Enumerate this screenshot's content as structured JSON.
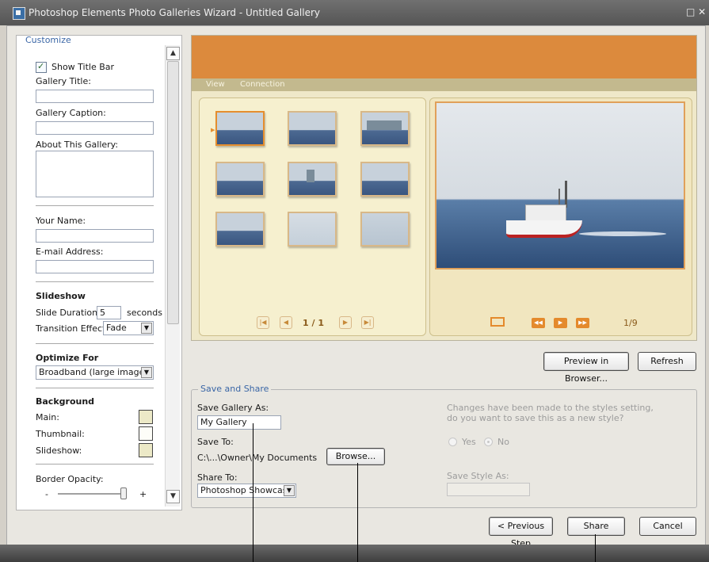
{
  "window": {
    "title": "Photoshop Elements Photo Galleries Wizard - Untitled Gallery",
    "close_glyph": "□ ✕"
  },
  "customize": {
    "legend": "Customize",
    "show_title_bar": {
      "label": "Show Title Bar",
      "checked": true
    },
    "gallery_title": {
      "label": "Gallery Title:",
      "value": ""
    },
    "gallery_caption": {
      "label": "Gallery Caption:",
      "value": ""
    },
    "about": {
      "label": "About This Gallery:",
      "value": ""
    },
    "your_name": {
      "label": "Your Name:",
      "value": ""
    },
    "email": {
      "label": "E-mail Address:",
      "value": ""
    },
    "slideshow": {
      "heading": "Slideshow",
      "duration_label": "Slide Duration:",
      "duration_value": "5",
      "duration_unit": "seconds",
      "transition_label": "Transition Effect:",
      "transition_value": "Fade"
    },
    "optimize": {
      "heading": "Optimize For",
      "value": "Broadband (large images)"
    },
    "background": {
      "heading": "Background",
      "main_label": "Main:",
      "main_color": "#ece9c7",
      "thumbnail_label": "Thumbnail:",
      "thumbnail_color": "#fdfdf8",
      "slideshow_label": "Slideshow:",
      "slideshow_color": "#ece9c7"
    },
    "border_opacity": {
      "label": "Border Opacity:",
      "minus": "-",
      "plus": "+",
      "level": 1.0
    }
  },
  "preview": {
    "header_color": "#dc8a3d",
    "menu": [
      "View",
      "Connection"
    ],
    "page_indicator": "1 / 1",
    "slide_counter": "1/9",
    "thumbnail_count": 9
  },
  "buttons": {
    "preview_in_browser": "Preview in Browser...",
    "refresh": "Refresh",
    "browse": "Browse...",
    "previous_step": "< Previous Step",
    "share": "Share",
    "cancel": "Cancel"
  },
  "save_share": {
    "legend": "Save and Share",
    "save_as_label": "Save Gallery As:",
    "save_as_value": "My Gallery",
    "save_to_label": "Save To:",
    "save_to_value": "C:\\...\\Owner\\My Documents",
    "share_to_label": "Share To:",
    "share_to_value": "Photoshop Showcase",
    "style_prompt_line1": "Changes have been made to the styles setting,",
    "style_prompt_line2": "do you want to save this as a new style?",
    "yes_label": "Yes",
    "no_label": "No",
    "selected": "No",
    "save_style_label": "Save Style As:",
    "save_style_value": ""
  }
}
